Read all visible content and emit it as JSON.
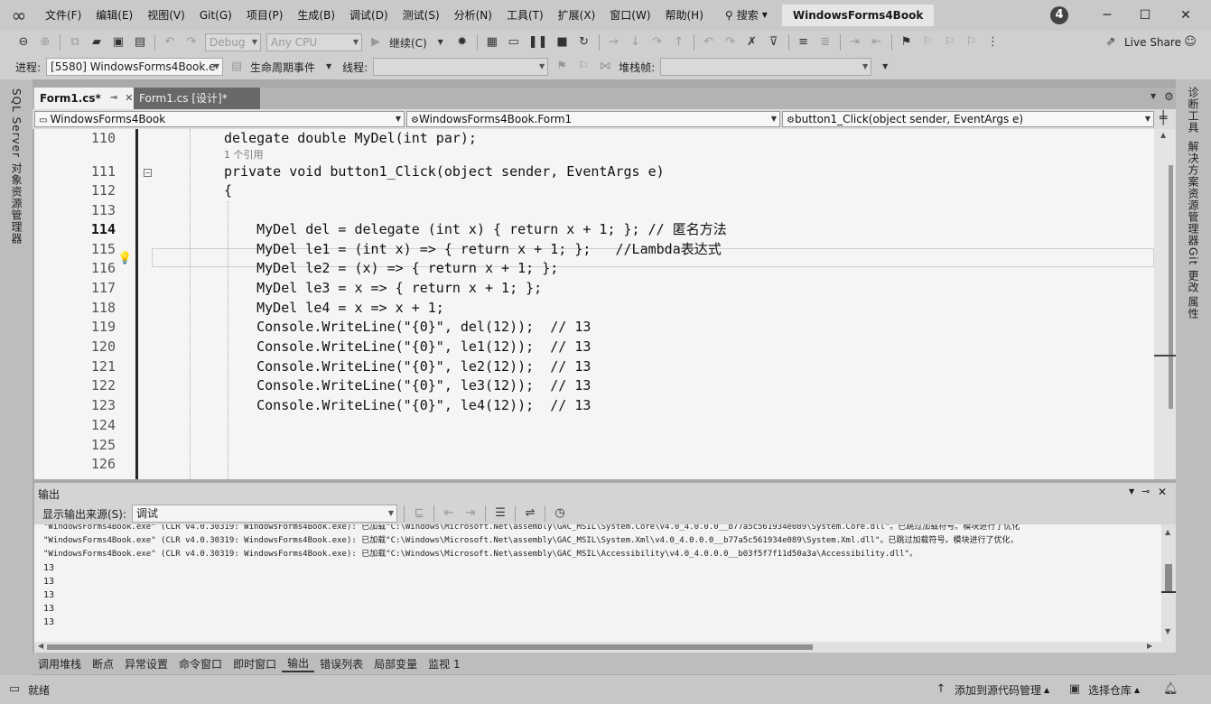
{
  "window": {
    "solution_title": "WindowsForms4Book",
    "badge": "4",
    "minimize": "─",
    "maximize": "☐",
    "close": "✕"
  },
  "menu": [
    {
      "label": "文件(F)"
    },
    {
      "label": "编辑(E)"
    },
    {
      "label": "视图(V)"
    },
    {
      "label": "Git(G)"
    },
    {
      "label": "项目(P)"
    },
    {
      "label": "生成(B)"
    },
    {
      "label": "调试(D)"
    },
    {
      "label": "测试(S)"
    },
    {
      "label": "分析(N)"
    },
    {
      "label": "工具(T)"
    },
    {
      "label": "扩展(X)"
    },
    {
      "label": "窗口(W)"
    },
    {
      "label": "帮助(H)"
    }
  ],
  "search_label": "搜索",
  "toolbar": {
    "config": "Debug",
    "platform": "Any CPU",
    "continue": "继续(C)",
    "live_share": "Live Share"
  },
  "debug_toolbar": {
    "process_label": "进程:",
    "process_value": "[5580] WindowsForms4Book.e",
    "lifecycle": "生命周期事件",
    "thread_label": "线程:",
    "thread_value": "",
    "stackframe_label": "堆栈帧:",
    "stackframe_value": ""
  },
  "left_sidebar": {
    "label": "SQL Server 对象资源管理器"
  },
  "right_sidebar": {
    "diag": "诊断工具",
    "solution": "解决方案资源管理器",
    "git": "Git 更改",
    "props": "属性"
  },
  "tabs": [
    {
      "label": "Form1.cs*"
    },
    {
      "label": "Form1.cs [设计]*"
    }
  ],
  "navbar": {
    "project": "WindowsForms4Book",
    "class": "WindowsForms4Book.Form1",
    "member": "button1_Click(object sender, EventArgs e)"
  },
  "code": {
    "ref_hint": "1 个引用",
    "lines": [
      {
        "n": "110",
        "t": "delegate double MyDel(int par);"
      },
      {
        "n": "111",
        "t": "private void button1_Click(object sender, EventArgs e)"
      },
      {
        "n": "112",
        "t": "{"
      },
      {
        "n": "113",
        "t": ""
      },
      {
        "n": "114",
        "t": "    MyDel del = delegate (int x) { return x + 1; }; // 匿名方法"
      },
      {
        "n": "115",
        "t": "    MyDel le1 = (int x) => { return x + 1; };   //Lambda表达式"
      },
      {
        "n": "116",
        "t": "    MyDel le2 = (x) => { return x + 1; };"
      },
      {
        "n": "117",
        "t": "    MyDel le3 = x => { return x + 1; };"
      },
      {
        "n": "118",
        "t": "    MyDel le4 = x => x + 1;"
      },
      {
        "n": "119",
        "t": "    Console.WriteLine(\"{0}\", del(12));  // 13"
      },
      {
        "n": "120",
        "t": "    Console.WriteLine(\"{0}\", le1(12));  // 13"
      },
      {
        "n": "121",
        "t": "    Console.WriteLine(\"{0}\", le2(12));  // 13"
      },
      {
        "n": "122",
        "t": "    Console.WriteLine(\"{0}\", le3(12));  // 13"
      },
      {
        "n": "123",
        "t": "    Console.WriteLine(\"{0}\", le4(12));  // 13"
      },
      {
        "n": "124",
        "t": ""
      },
      {
        "n": "125",
        "t": ""
      },
      {
        "n": "126",
        "t": ""
      }
    ]
  },
  "output": {
    "title": "输出",
    "source_label": "显示输出来源(S):",
    "source_value": "调试",
    "lines": [
      "\"WindowsForms4Book.exe\" (CLR v4.0.30319: WindowsForms4Book.exe): 已加载\"C:\\Windows\\Microsoft.Net\\assembly\\GAC_MSIL\\System.Core\\v4.0_4.0.0.0__b77a5c561934e089\\System.Core.dll\"。已跳过加载符号。模块进行了优化",
      "\"WindowsForms4Book.exe\" (CLR v4.0.30319: WindowsForms4Book.exe): 已加载\"C:\\Windows\\Microsoft.Net\\assembly\\GAC_MSIL\\System.Xml\\v4.0_4.0.0.0__b77a5c561934e089\\System.Xml.dll\"。已跳过加载符号。模块进行了优化，",
      "\"WindowsForms4Book.exe\" (CLR v4.0.30319: WindowsForms4Book.exe): 已加载\"C:\\Windows\\Microsoft.Net\\assembly\\GAC_MSIL\\Accessibility\\v4.0_4.0.0.0__b03f5f7f11d50a3a\\Accessibility.dll\"。",
      "13",
      "13",
      "13",
      "13",
      "13"
    ]
  },
  "bottom_tabs": [
    {
      "label": "调用堆栈"
    },
    {
      "label": "断点"
    },
    {
      "label": "异常设置"
    },
    {
      "label": "命令窗口"
    },
    {
      "label": "即时窗口"
    },
    {
      "label": "输出"
    },
    {
      "label": "错误列表"
    },
    {
      "label": "局部变量"
    },
    {
      "label": "监视 1"
    }
  ],
  "status": {
    "ready": "就绪",
    "add_source": "添加到源代码管理",
    "select_repo": "选择仓库"
  }
}
